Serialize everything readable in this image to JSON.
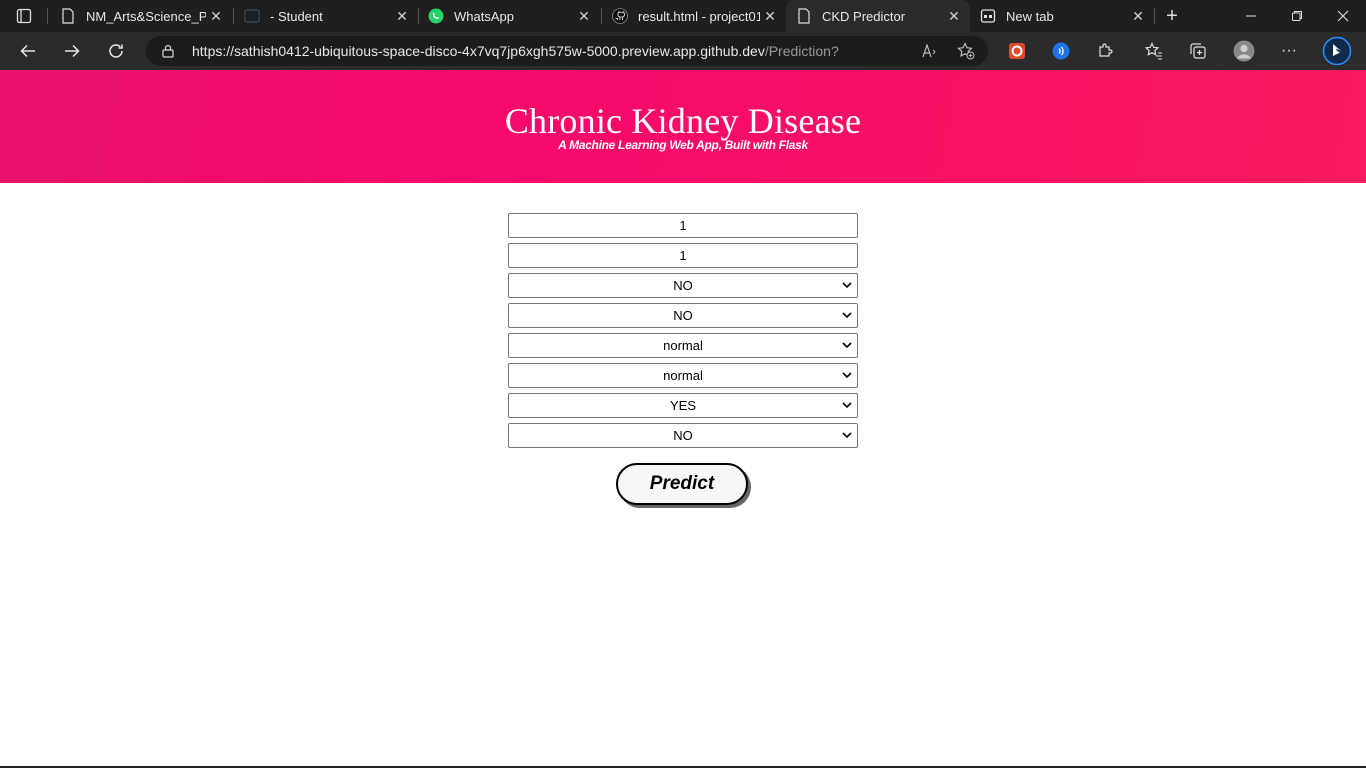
{
  "browser": {
    "tabs": [
      {
        "title": "NM_Arts&Science_Proj",
        "icon": "document-icon"
      },
      {
        "title": "- Student",
        "icon": "codespace-icon"
      },
      {
        "title": "WhatsApp",
        "icon": "whatsapp-icon"
      },
      {
        "title": "result.html - project01",
        "icon": "github-icon"
      },
      {
        "title": "CKD Predictor",
        "icon": "document-icon",
        "active": true
      },
      {
        "title": "New tab",
        "icon": "newtab-icon"
      }
    ],
    "address": {
      "url_main": "https://sathish0412-ubiquitous-space-disco-4x7vq7jp6xgh575w-5000.preview.app.github.dev",
      "url_path": "/Prediction?"
    }
  },
  "header": {
    "title": "Chronic Kidney Disease",
    "subtitle": "A Machine Learning Web App, Built with Flask"
  },
  "form": {
    "input1": "1",
    "input2": "1",
    "select1": "NO",
    "select2": "NO",
    "select3": "normal",
    "select4": "normal",
    "select5": "YES",
    "select6": "NO",
    "submit_label": "Predict"
  },
  "colors": {
    "hero": "#f50d6a",
    "chrome_dark": "#1f1f1f",
    "toolbar": "#2b2b2b"
  }
}
